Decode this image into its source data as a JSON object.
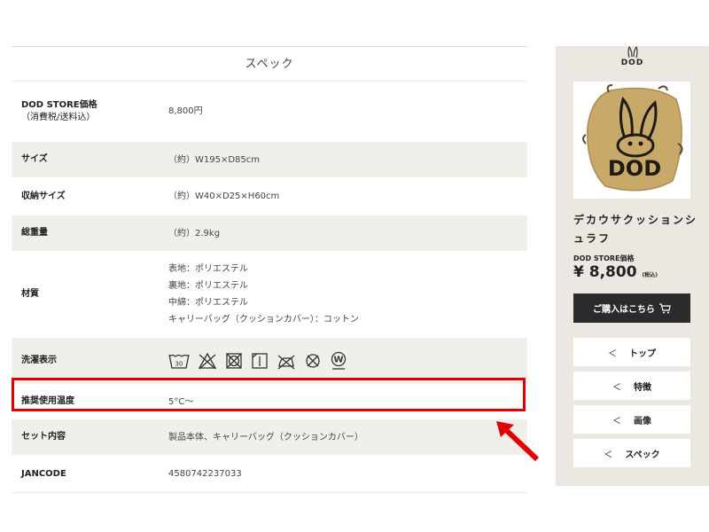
{
  "spec": {
    "title": "スペック",
    "rows": [
      {
        "key_line1": "DOD STORE価格",
        "key_line2": "（消費税/送料込）",
        "value": "8,800円"
      },
      {
        "key": "サイズ",
        "value": "（約）W195×D85cm"
      },
      {
        "key": "収納サイズ",
        "value": "（約）W40×D25×H60cm"
      },
      {
        "key": "総重量",
        "value": "（約）2.9kg"
      },
      {
        "key": "材質",
        "values": [
          "表地：ポリエステル",
          "裏地：ポリエステル",
          "中綿：ポリエステル",
          "キャリーバッグ（クッションカバー）：コットン"
        ]
      },
      {
        "key": "洗濯表示"
      },
      {
        "key": "推奨使用温度",
        "value": "5°C～"
      },
      {
        "key": "セット内容",
        "value": "製品本体、キャリーバッグ（クッションカバー）"
      },
      {
        "key": "JANCODE",
        "value": "4580742237033"
      }
    ],
    "wash_icons": [
      "wash-30-icon",
      "no-bleach-icon",
      "no-tumble-dry-icon",
      "drip-dry-icon",
      "no-iron-icon",
      "no-dry-clean-icon",
      "wet-clean-icon"
    ],
    "wash_tub_label": "30",
    "wet_clean_label": "W"
  },
  "sidebar": {
    "logo_text": "DOD",
    "product_logo_text": "DOD",
    "product_name": "デカウサクッションシュラフ",
    "price_label": "DOD STORE価格",
    "price": "¥ 8,800",
    "tax": "(税込)",
    "buy_button": "ご購入はこちら",
    "nav": [
      "トップ",
      "特徴",
      "画像",
      "スペック"
    ],
    "chevron": "＜"
  },
  "colors": {
    "highlight": "#e30000",
    "stripe": "#f1efea",
    "sidebar_bg": "#ece8e1",
    "button_bg": "#2b2b2b",
    "product": "#c9a96a"
  }
}
